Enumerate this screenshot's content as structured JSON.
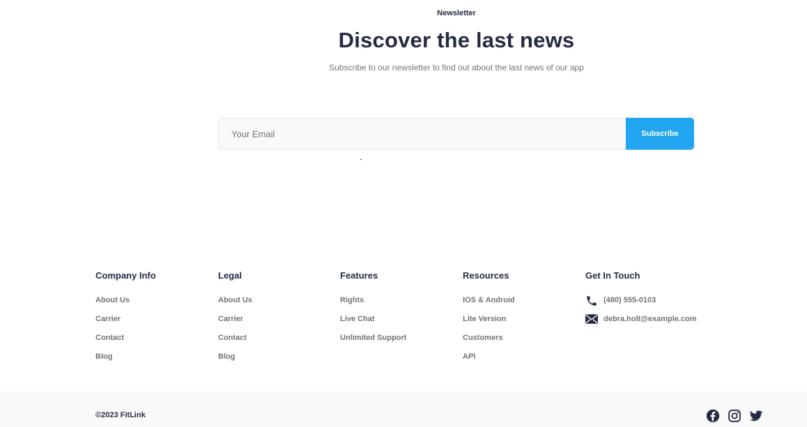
{
  "newsletter": {
    "kicker": "Newsletter",
    "title": "Discover the last news",
    "subtitle": "Subscribe to our newsletter to find out about the last news of our app",
    "email_placeholder": "Your Email",
    "subscribe_label": "Subscribe"
  },
  "footer": {
    "columns": [
      {
        "title": "Company Info",
        "links": [
          "About Us",
          "Carrier",
          "Contact",
          "Blog"
        ]
      },
      {
        "title": "Legal",
        "links": [
          "About Us",
          "Carrier",
          "Contact",
          "Blog"
        ]
      },
      {
        "title": "Features",
        "links": [
          "Rights",
          "Live Chat",
          "Unlimited Support"
        ]
      },
      {
        "title": "Resources",
        "links": [
          "IOS & Android",
          "Lite Version",
          "Customers",
          "API"
        ]
      }
    ],
    "contact": {
      "title": "Get In Touch",
      "phone": "(480) 555-0103",
      "phone_icon": "phone-icon",
      "email": "debra.holt@example.com",
      "email_icon": "mail-icon"
    },
    "copyright": "©2023 FitLink",
    "socials": [
      "facebook-icon",
      "instagram-icon",
      "twitter-icon"
    ]
  },
  "colors": {
    "primary": "#23A6F0",
    "heading": "#252B42",
    "text_muted": "#737373",
    "bar_bg": "#FAFAFA"
  }
}
